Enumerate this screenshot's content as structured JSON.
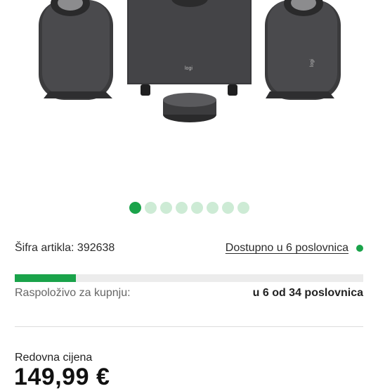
{
  "product": {
    "image_alt": "Logitech speakers with subwoofer and control pod",
    "logo_text": "logi",
    "gallery": {
      "count": 8,
      "active_index": 0
    }
  },
  "sku": {
    "label": "Šifra artikla: 392638"
  },
  "availability": {
    "link_text": "Dostupno u 6 poslovnica",
    "status_color": "#1aa34a",
    "progress_fraction": 0.176,
    "label": "Raspoloživo za kupnju:",
    "value": "u 6 od 34 poslovnica"
  },
  "price": {
    "label": "Redovna cijena",
    "value": "149,99 €"
  },
  "colors": {
    "accent": "#1aa34a",
    "dot_inactive": "#cdebd5"
  }
}
